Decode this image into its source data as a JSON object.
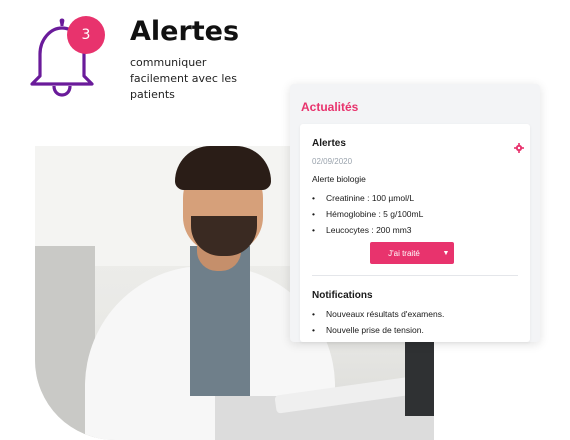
{
  "hero": {
    "title": "Alertes",
    "subtitle": "communiquer facilement avec les patients",
    "badge_count": "3",
    "bell_icon": "bell-icon",
    "colors": {
      "bell": "#6a1b9a",
      "accent": "#e8336d"
    }
  },
  "card": {
    "title": "Actualités",
    "alert": {
      "heading": "Alertes",
      "settings_icon": "gear-icon",
      "date": "02/09/2020",
      "subtitle": "Alerte biologie",
      "items": [
        "Creatinine : 100 µmol/L",
        "Hémoglobine : 5 g/100mL",
        "Leucocytes : 200 mm3"
      ],
      "action_label": "J'ai traité",
      "action_caret_icon": "caret-down-icon"
    },
    "notifications": {
      "heading": "Notifications",
      "items": [
        "Nouveaux résultats d'examens.",
        "Nouvelle prise de tension."
      ]
    }
  }
}
